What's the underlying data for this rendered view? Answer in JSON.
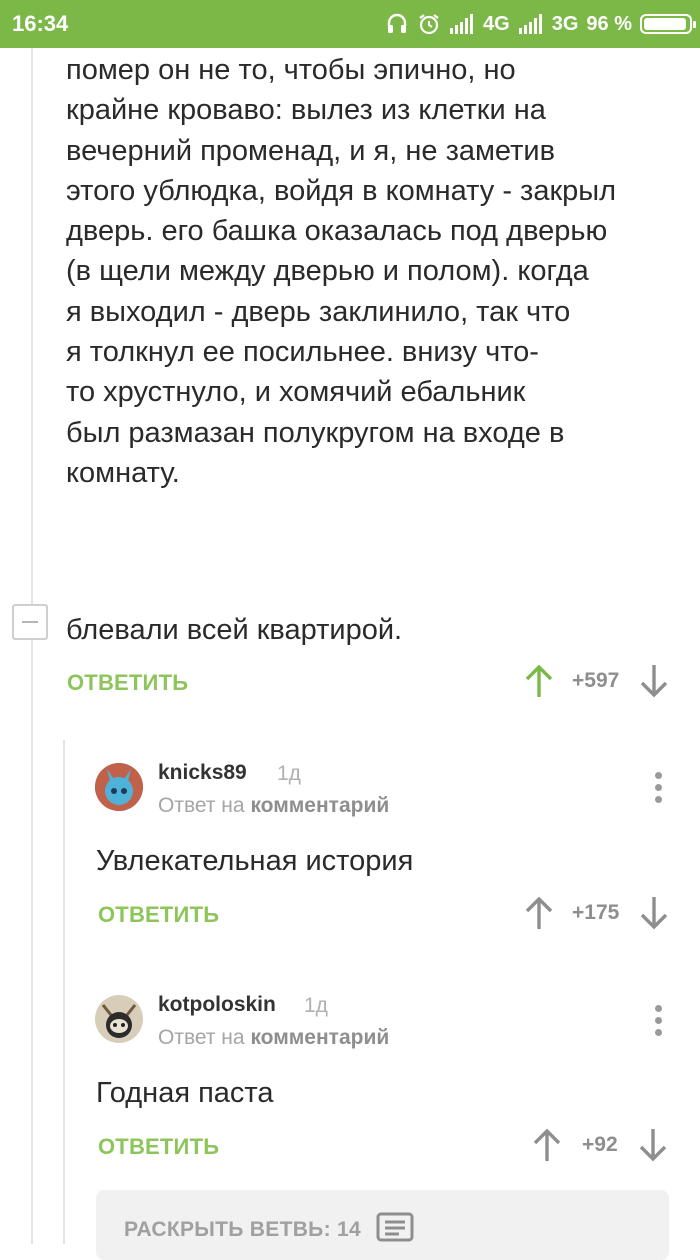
{
  "status_bar": {
    "time": "16:34",
    "net1": "4G",
    "net2": "3G",
    "battery": "96 %",
    "battery_level": 0.96
  },
  "comment_main": {
    "lines": [
      "помер он не то, чтобы эпично, но",
      "крайне кроваво: вылез из клетки на",
      "вечерний променад, и я, не заметив",
      "этого ублюдка, войдя в комнату - закрыл",
      "дверь. его башка оказалась под дверью",
      "(в щели между дверью и полом). когда",
      "я выходил - дверь заклинило, так что",
      "я толкнул ее посильнее. внизу что-",
      "то хрустнуло, и хомячий ебальник",
      "был размазан полукругом на входе в",
      "комнату."
    ],
    "last_line": "блевали всей квартирой.",
    "reply_label": "ОТВЕТИТЬ",
    "rating": "+597"
  },
  "replies": [
    {
      "username": "knicks89",
      "age": "1д",
      "reply_prefix": "Ответ на",
      "reply_target": "комментарий",
      "text": "Увлекательная история",
      "reply_label": "ОТВЕТИТЬ",
      "rating": "+175"
    },
    {
      "username": "kotpoloskin",
      "age": "1д",
      "reply_prefix": "Ответ на",
      "reply_target": "комментарий",
      "text": "Годная паста",
      "reply_label": "ОТВЕТИТЬ",
      "rating": "+92"
    }
  ],
  "expand_branch": {
    "label": "РАСКРЫТЬ ВЕТВЬ: 14"
  },
  "colors": {
    "status_bar": "#7bb848",
    "accent_green": "#8dc55b",
    "upvoted": "#7bb848"
  }
}
